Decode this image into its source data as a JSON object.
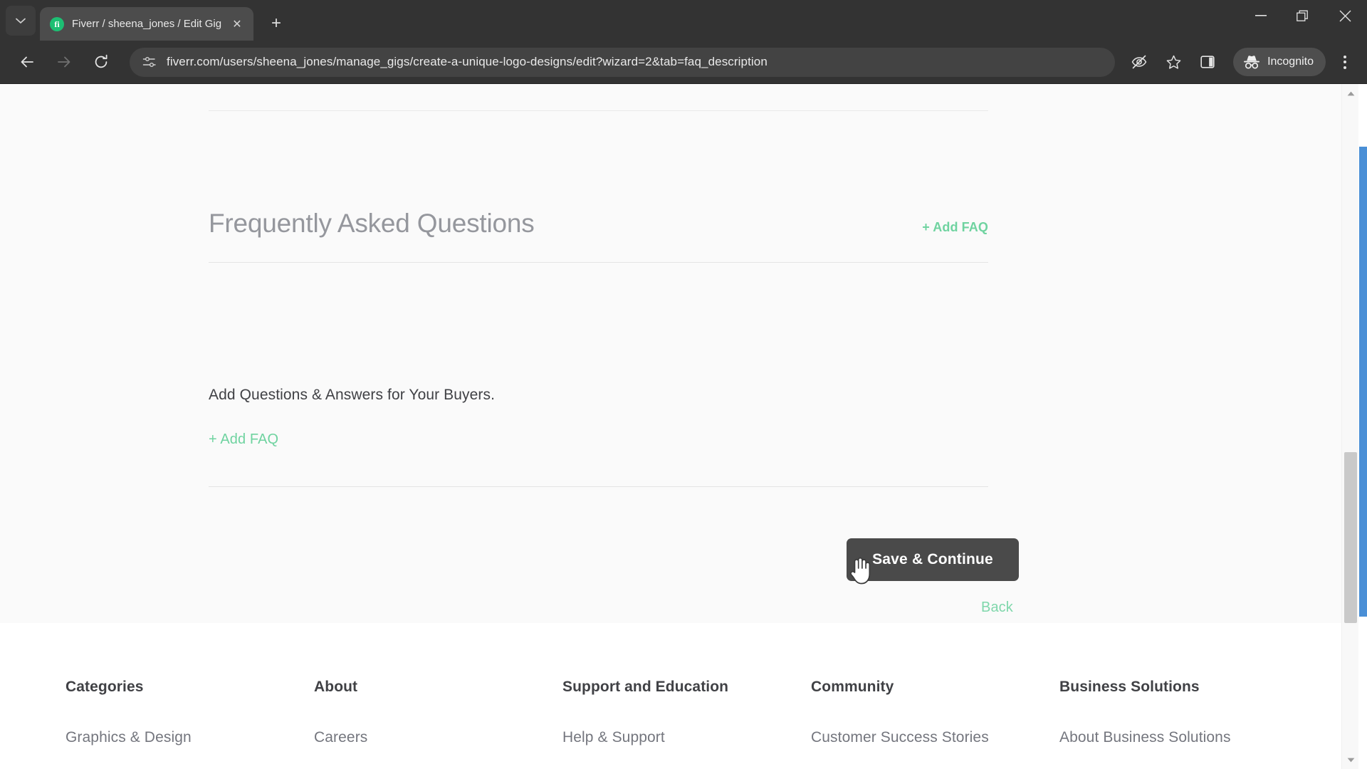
{
  "browser": {
    "tab": {
      "favicon_name": "fiverr-favicon",
      "favicon_letters": "fi",
      "title": "Fiverr / sheena_jones / Edit Gig",
      "close_glyph": "✕"
    },
    "tab_search_glyph": "⌄",
    "new_tab_glyph": "+",
    "window_controls": {
      "minimize": "—",
      "restore": "❐",
      "close": "✕"
    },
    "toolbar": {
      "back_glyph": "←",
      "forward_glyph": "→",
      "reload_glyph": "⟳",
      "url": "fiverr.com/users/sheena_jones/manage_gigs/create-a-unique-logo-designs/edit?wizard=2&tab=faq_description",
      "site_info_name": "site-settings-icon",
      "tracking_protection_name": "eye-off-icon",
      "bookmark_name": "star-icon",
      "side_panel_name": "side-panel-icon",
      "incognito_label": "Incognito",
      "menu_name": "three-dot-menu-icon"
    }
  },
  "page": {
    "faq_section": {
      "title": "Frequently Asked Questions",
      "add_faq_top": "+ Add FAQ",
      "subtitle": "Add Questions & Answers for Your Buyers.",
      "add_faq_bottom": "+ Add FAQ"
    },
    "actions": {
      "save_label": "Save & Continue",
      "back_label": "Back"
    },
    "footer": {
      "columns": [
        {
          "heading": "Categories",
          "links": [
            "Graphics & Design"
          ]
        },
        {
          "heading": "About",
          "links": [
            "Careers"
          ]
        },
        {
          "heading": "Support and Education",
          "links": [
            "Help & Support"
          ]
        },
        {
          "heading": "Community",
          "links": [
            "Customer Success Stories"
          ]
        },
        {
          "heading": "Business Solutions",
          "links": [
            "About Business Solutions"
          ]
        }
      ]
    }
  },
  "colors": {
    "fiverr_green": "#1dbf73",
    "link_green": "#6fd3a0",
    "button_gray": "#4a4a4a",
    "chrome_dark": "#333333",
    "page_bg": "#fafafa"
  }
}
